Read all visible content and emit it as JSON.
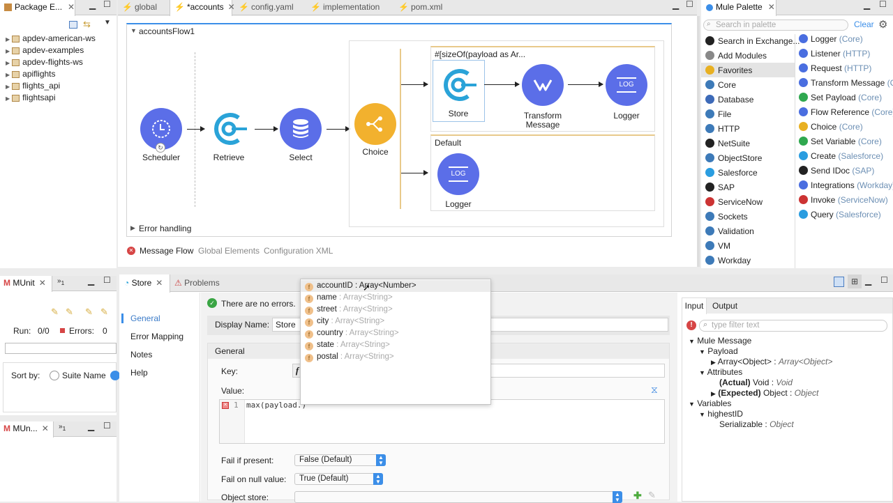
{
  "package_explorer": {
    "tab_label": "Package E...",
    "projects": [
      "apdev-american-ws",
      "apdev-examples",
      "apdev-flights-ws",
      "apiflights",
      "flights_api",
      "flightsapi"
    ]
  },
  "editor_tabs": [
    {
      "label": "global"
    },
    {
      "label": "*accounts"
    },
    {
      "label": "config.yaml"
    },
    {
      "label": "implementation"
    },
    {
      "label": "pom.xml"
    }
  ],
  "canvas": {
    "flow_name": "accountsFlow1",
    "nodes": {
      "scheduler": "Scheduler",
      "retrieve": "Retrieve",
      "select": "Select",
      "choice": "Choice",
      "store": "Store",
      "transform": "Transform\nMessage",
      "logger1": "Logger",
      "logger2": "Logger"
    },
    "route1_expr": "#[sizeOf(payload as Ar...",
    "route2_label": "Default",
    "error_handling": "Error handling",
    "logger_icon_text": "LOG"
  },
  "editor_bottom_tabs": {
    "message_flow": "Message Flow",
    "global_elements": "Global Elements",
    "configuration_xml": "Configuration XML"
  },
  "palette": {
    "tab_label": "Mule Palette",
    "search_placeholder": "Search in palette",
    "clear_label": "Clear",
    "left_items": [
      {
        "label": "Search in Exchange...",
        "icon": "exchange-icon",
        "color": "#222"
      },
      {
        "label": "Add Modules",
        "icon": "plus-circle-icon",
        "color": "#888"
      },
      {
        "label": "Favorites",
        "icon": "star-icon",
        "color": "#e8b022"
      },
      {
        "label": "Core",
        "icon": "core-icon",
        "color": "#3d7ab8"
      },
      {
        "label": "Database",
        "icon": "database-icon",
        "color": "#3d6ab8"
      },
      {
        "label": "File",
        "icon": "file-icon",
        "color": "#3d7ab8"
      },
      {
        "label": "HTTP",
        "icon": "http-icon",
        "color": "#3d7ab8"
      },
      {
        "label": "NetSuite",
        "icon": "netsuite-icon",
        "color": "#222"
      },
      {
        "label": "ObjectStore",
        "icon": "objectstore-icon",
        "color": "#3d7ab8"
      },
      {
        "label": "Salesforce",
        "icon": "salesforce-icon",
        "color": "#2a9de0"
      },
      {
        "label": "SAP",
        "icon": "sap-icon",
        "color": "#222"
      },
      {
        "label": "ServiceNow",
        "icon": "servicenow-icon",
        "color": "#c33"
      },
      {
        "label": "Sockets",
        "icon": "sockets-icon",
        "color": "#3d7ab8"
      },
      {
        "label": "Validation",
        "icon": "validation-icon",
        "color": "#3d7ab8"
      },
      {
        "label": "VM",
        "icon": "vm-icon",
        "color": "#3d7ab8"
      },
      {
        "label": "Workday",
        "icon": "workday-icon",
        "color": "#3d7ab8"
      }
    ],
    "right_items": [
      {
        "name": "Logger",
        "source": "(Core)",
        "icon": "logger-icon",
        "color": "#4a6ee0"
      },
      {
        "name": "Listener",
        "source": "(HTTP)",
        "icon": "listener-icon",
        "color": "#4a6ee0"
      },
      {
        "name": "Request",
        "source": "(HTTP)",
        "icon": "request-icon",
        "color": "#4a6ee0"
      },
      {
        "name": "Transform Message",
        "source": "(C",
        "icon": "transform-icon",
        "color": "#4a6ee0"
      },
      {
        "name": "Set Payload",
        "source": "(Core)",
        "icon": "set-payload-icon",
        "color": "#2fa84f"
      },
      {
        "name": "Flow Reference",
        "source": "(Core)",
        "icon": "flow-reference-icon",
        "color": "#4a6ee0"
      },
      {
        "name": "Choice",
        "source": "(Core)",
        "icon": "choice-icon",
        "color": "#e8b022"
      },
      {
        "name": "Set Variable",
        "source": "(Core)",
        "icon": "set-variable-icon",
        "color": "#2fa84f"
      },
      {
        "name": "Create",
        "source": "(Salesforce)",
        "icon": "salesforce-icon",
        "color": "#2a9de0"
      },
      {
        "name": "Send IDoc",
        "source": "(SAP)",
        "icon": "sap-icon",
        "color": "#222"
      },
      {
        "name": "Integrations",
        "source": "(Workday)",
        "icon": "workday-icon",
        "color": "#4a6ee0"
      },
      {
        "name": "Invoke",
        "source": "(ServiceNow)",
        "icon": "servicenow-icon",
        "color": "#c33"
      },
      {
        "name": "Query",
        "source": "(Salesforce)",
        "icon": "salesforce-icon",
        "color": "#2a9de0"
      }
    ]
  },
  "munit": {
    "tab_label": "MUnit",
    "overflow_count": "1",
    "run_label": "Run:",
    "run_value": "0/0",
    "errors_label": "Errors:",
    "errors_value": "0",
    "sort_by_label": "Sort by:",
    "suite_name_label": "Suite Name",
    "tab2_label": "MUn...",
    "tab2_overflow": "1"
  },
  "store_panel": {
    "tab_store": "Store",
    "tab_problems": "Problems",
    "nav": [
      "General",
      "Error Mapping",
      "Notes",
      "Help"
    ],
    "status": "There are no errors.",
    "display_name_label": "Display Name:",
    "display_name_value": "Store",
    "section_general": "General",
    "key_label": "Key:",
    "key_fx": "f",
    "value_label": "Value:",
    "code_line_no": "1",
    "code_text": "max(payload.)",
    "fail_if_present_label": "Fail if present:",
    "fail_if_present_value": "False (Default)",
    "fail_on_null_label": "Fail on null value:",
    "fail_on_null_value": "True (Default)",
    "object_store_label": "Object store:"
  },
  "autocomplete": [
    {
      "name": "accountID",
      "type": "Array<Number>"
    },
    {
      "name": "name",
      "type": "Array<String>"
    },
    {
      "name": "street",
      "type": "Array<String>"
    },
    {
      "name": "city",
      "type": "Array<String>"
    },
    {
      "name": "country",
      "type": "Array<String>"
    },
    {
      "name": "state",
      "type": "Array<String>"
    },
    {
      "name": "postal",
      "type": "Array<String>"
    }
  ],
  "metadata": {
    "tab_input": "Input",
    "tab_output": "Output",
    "filter_placeholder": "type filter text",
    "mule_message": "Mule Message",
    "payload": "Payload",
    "payload_type_a": "Array<Object>",
    "payload_type_b": "Array<Object>",
    "attributes": "Attributes",
    "actual_label": "(Actual)",
    "actual_type": "Void",
    "actual_type2": "Void",
    "expected_label": "(Expected)",
    "expected_type": "Object",
    "expected_type2": "Object",
    "variables": "Variables",
    "var_name": "highestID",
    "var_type": "Serializable",
    "var_type2": "Object"
  },
  "colors": {
    "node_blue": "#5b6ee8",
    "node_yellow": "#f2b12e",
    "selection_blue": "#4a90e2",
    "error_red": "#d64545",
    "ok_green": "#3aa544",
    "route_border": "#e8c98a"
  }
}
